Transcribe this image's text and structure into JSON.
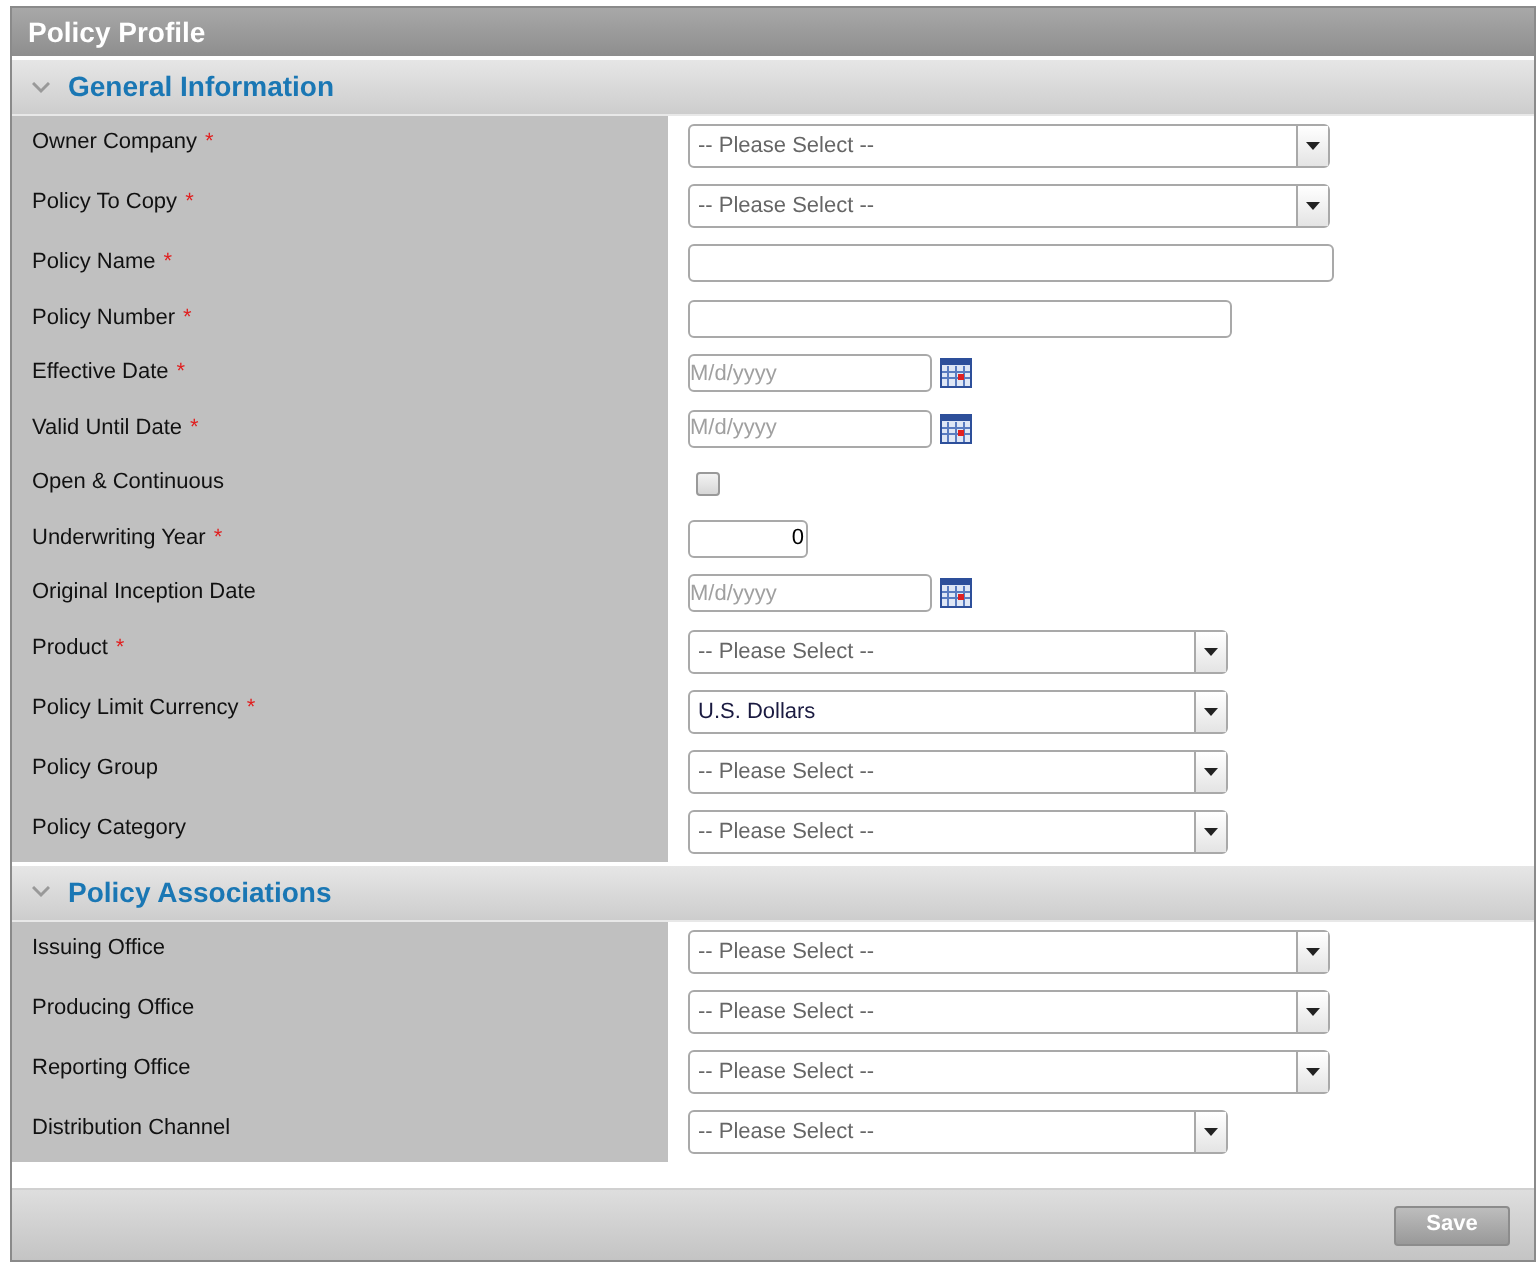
{
  "window": {
    "title": "Policy Profile"
  },
  "sections": [
    {
      "title": "General Information",
      "expanded": true,
      "fields": [
        {
          "label": "Owner Company",
          "required_mark": "*",
          "kind": "select",
          "wide": true,
          "value": "-- Please Select --",
          "placeholder_shown": true
        },
        {
          "label": "Policy To Copy",
          "required_mark": "*",
          "kind": "select",
          "wide": true,
          "value": "-- Please Select --",
          "placeholder_shown": true
        },
        {
          "label": "Policy Name",
          "required_mark": "*",
          "kind": "text",
          "wide": true
        },
        {
          "label": "Policy Number",
          "required_mark": "*",
          "kind": "text",
          "wide": false
        },
        {
          "label": "Effective Date",
          "required_mark": "*",
          "kind": "date",
          "placeholder": "M/d/yyyy"
        },
        {
          "label": "Valid Until Date",
          "required_mark": "*",
          "kind": "date",
          "placeholder": "M/d/yyyy"
        },
        {
          "label": "Open & Continuous",
          "kind": "checkbox",
          "checked": false
        },
        {
          "label": "Underwriting Year",
          "required_mark": "*",
          "kind": "number",
          "value": "0"
        },
        {
          "label": "Original Inception Date",
          "kind": "date",
          "placeholder": "M/d/yyyy"
        },
        {
          "label": "Product",
          "required_mark": "*",
          "kind": "select",
          "wide": false,
          "value": "-- Please Select --",
          "placeholder_shown": true
        },
        {
          "label": "Policy Limit Currency",
          "required_mark": "*",
          "kind": "select",
          "wide": false,
          "value": "U.S. Dollars",
          "placeholder_shown": false
        },
        {
          "label": "Policy Group",
          "kind": "select",
          "wide": false,
          "value": "-- Please Select --",
          "placeholder_shown": true
        },
        {
          "label": "Policy Category",
          "kind": "select",
          "wide": false,
          "value": "-- Please Select --",
          "placeholder_shown": true
        }
      ]
    },
    {
      "title": "Policy Associations",
      "expanded": true,
      "fields": [
        {
          "label": "Issuing Office",
          "kind": "select",
          "wide": true,
          "value": "-- Please Select --",
          "placeholder_shown": true
        },
        {
          "label": "Producing Office",
          "kind": "select",
          "wide": true,
          "value": "-- Please Select --",
          "placeholder_shown": true
        },
        {
          "label": "Reporting Office",
          "kind": "select",
          "wide": true,
          "value": "-- Please Select --",
          "placeholder_shown": true
        },
        {
          "label": "Distribution Channel",
          "kind": "select",
          "wide": false,
          "value": "-- Please Select --",
          "placeholder_shown": true
        }
      ]
    }
  ],
  "footer": {
    "buttons": [
      "Save"
    ]
  }
}
